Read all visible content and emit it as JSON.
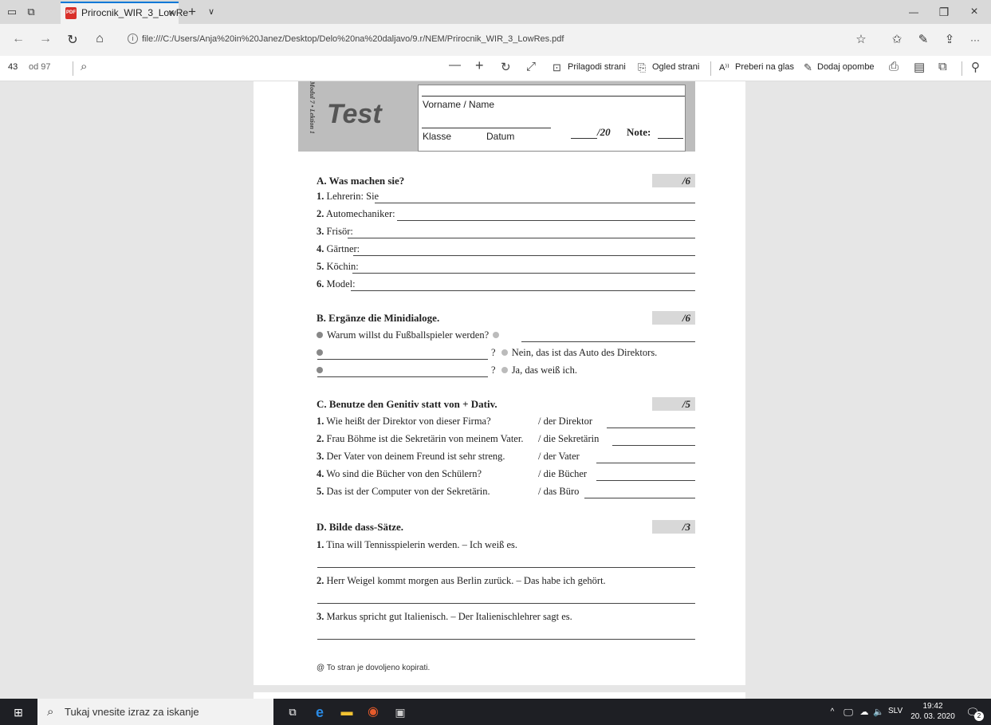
{
  "browser": {
    "tab_title": "Prirocnik_WIR_3_LowRe",
    "tab_close": "×",
    "new_tab": "+",
    "tab_list": "∨",
    "minimize": "—",
    "restore": "❐",
    "close": "×",
    "url": "file:///C:/Users/Anja%20in%20Janez/Desktop/Delo%20na%20daljavo/9.r/NEM/Prirocnik_WIR_3_LowRes.pdf",
    "info_glyph": "i",
    "more": "···"
  },
  "pdf_toolbar": {
    "page_number": "43",
    "page_total": "od 97",
    "zoom_out": "—",
    "zoom_in": "+",
    "fit_page": "Prilagodi strani",
    "page_view": "Ogled strani",
    "read_aloud_icon": "A⁾⁾",
    "read_aloud": "Preberi na glas",
    "add_notes": "Dodaj opombe"
  },
  "document": {
    "modul_label": "Modul 7 • Lektion 1",
    "test_word": "Test",
    "name_label": "Vorname / Name",
    "klasse_label": "Klasse",
    "datum_label": "Datum",
    "total_score": "/20",
    "note_label": "Note:",
    "sections": {
      "a": {
        "title": "A. Was machen sie?",
        "score": "/6",
        "items": [
          {
            "num": "1.",
            "text": "Lehrerin: Sie"
          },
          {
            "num": "2.",
            "text": "Automechaniker:"
          },
          {
            "num": "3.",
            "text": "Frisör:"
          },
          {
            "num": "4.",
            "text": "Gärtner:"
          },
          {
            "num": "5.",
            "text": "Köchin:"
          },
          {
            "num": "6.",
            "text": "Model:"
          }
        ]
      },
      "b": {
        "title": "B. Ergänze die Minidialoge.",
        "score": "/6",
        "line1": "Warum willst du Fußballspieler werden?",
        "line2_q": "?",
        "line2_a": "Nein, das ist das Auto des Direktors.",
        "line3_q": "?",
        "line3_a": "Ja, das weiß ich."
      },
      "c": {
        "title": "C. Benutze den Genitiv statt von + Dativ.",
        "score": "/5",
        "items": [
          {
            "num": "1.",
            "text": "Wie heißt der Direktor von dieser Firma?",
            "hint": "/ der Direktor"
          },
          {
            "num": "2.",
            "text": "Frau Böhme ist die Sekretärin von meinem Vater.",
            "hint": "/ die Sekretärin"
          },
          {
            "num": "3.",
            "text": "Der Vater von deinem Freund ist sehr streng.",
            "hint": "/ der Vater"
          },
          {
            "num": "4.",
            "text": "Wo sind die Bücher von den Schülern?",
            "hint": "/ die Bücher"
          },
          {
            "num": "5.",
            "text": "Das ist der Computer von der Sekretärin.",
            "hint": "/ das Büro"
          }
        ]
      },
      "d": {
        "title": "D. Bilde dass-Sätze.",
        "score": "/3",
        "items": [
          {
            "num": "1.",
            "text": "Tina will Tennisspielerin werden. – Ich weiß es."
          },
          {
            "num": "2.",
            "text": "Herr Weigel kommt morgen aus Berlin zurück. – Das habe ich gehört."
          },
          {
            "num": "3.",
            "text": "Markus spricht gut Italienisch. – Der Italienischlehrer sagt es."
          }
        ]
      }
    },
    "footer": "@ To stran je dovoljeno kopirati."
  },
  "taskbar": {
    "search_placeholder": "Tukaj vnesite izraz za iskanje",
    "language": "SLV",
    "time": "19:42",
    "date": "20. 03. 2020",
    "notifications": "2",
    "tray_chevron": "^"
  },
  "colors": {
    "accent": "#0078d7",
    "pdf_red": "#d9302a",
    "taskbar": "#1e1f24"
  }
}
